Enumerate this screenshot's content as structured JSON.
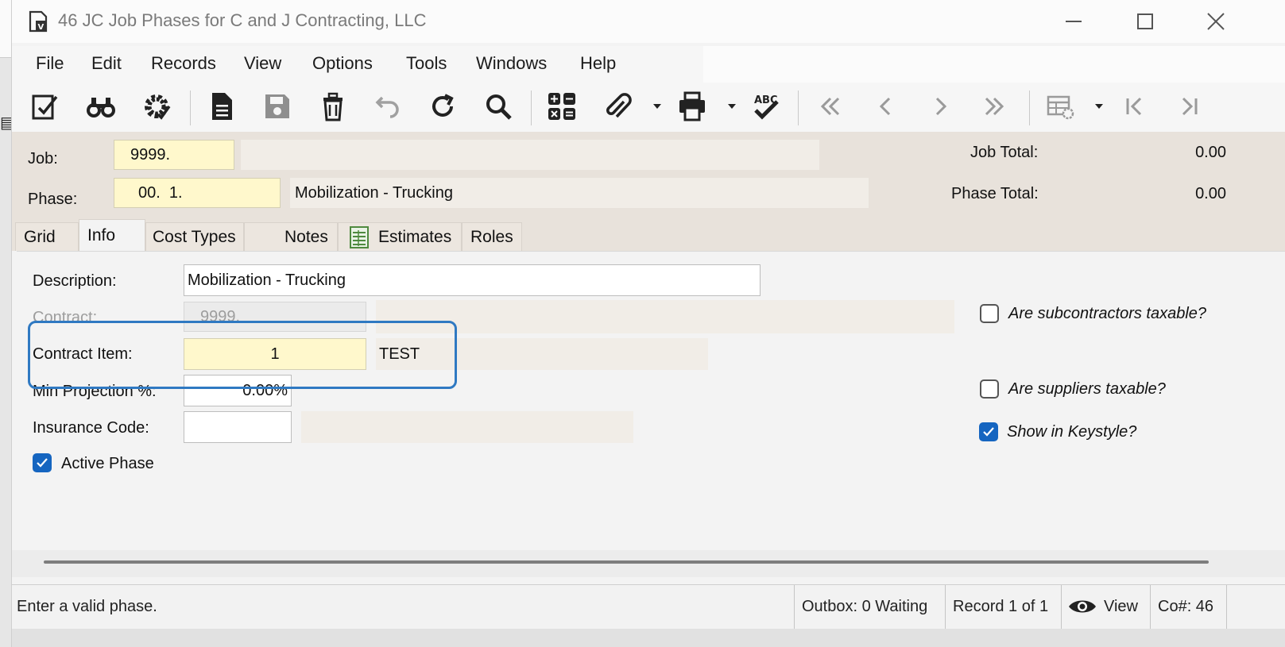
{
  "window": {
    "title": "46 JC Job Phases for C and J Contracting, LLC",
    "controls": [
      "minimize",
      "maximize",
      "close"
    ]
  },
  "menu": [
    "File",
    "Edit",
    "Records",
    "View",
    "Options",
    "Tools",
    "Windows",
    "Help"
  ],
  "toolbar": {
    "icons": [
      "validate-icon",
      "find-icon",
      "settings-icon",
      "new-record-icon",
      "save-icon",
      "delete-icon",
      "undo-icon",
      "refresh-icon",
      "search-icon",
      "calculator-icon",
      "attachment-icon",
      "print-icon",
      "spellcheck-icon",
      "first-record-icon",
      "previous-record-icon",
      "next-record-icon",
      "last-record-icon",
      "grid-settings-icon",
      "go-first-icon",
      "go-last-icon"
    ],
    "disabled": [
      "save-icon",
      "undo-icon",
      "first-record-icon",
      "previous-record-icon",
      "next-record-icon",
      "last-record-icon",
      "grid-settings-icon",
      "go-first-icon",
      "go-last-icon"
    ]
  },
  "header": {
    "job_label": "Job:",
    "job_value": "9999.",
    "job_desc": "",
    "phase_label": "Phase:",
    "phase_value": "00.  1.",
    "phase_desc": "Mobilization - Trucking",
    "job_total_label": "Job Total:",
    "job_total": "0.00",
    "phase_total_label": "Phase Total:",
    "phase_total": "0.00"
  },
  "tabs": [
    {
      "label": "Grid",
      "active": false
    },
    {
      "label": "Info",
      "active": true
    },
    {
      "label": "Cost Types",
      "active": false
    },
    {
      "label": "Notes",
      "active": false
    },
    {
      "label": "Estimates",
      "active": false
    },
    {
      "label": "Roles",
      "active": false
    }
  ],
  "info": {
    "description_label": "Description:",
    "description_value": "Mobilization - Trucking",
    "contract_label": "Contract:",
    "contract_value": "9999.",
    "contract_item_label": "Contract Item:",
    "contract_item_value": "1",
    "contract_item_desc": "TEST",
    "min_projection_label": "Min Projection %:",
    "min_projection_value": "0.00%",
    "insurance_code_label": "Insurance Code:",
    "insurance_code_value": "",
    "active_phase_label": "Active Phase",
    "active_phase_checked": true,
    "subcontractors_taxable_label": "Are subcontractors taxable?",
    "subcontractors_taxable_checked": false,
    "suppliers_taxable_label": "Are suppliers taxable?",
    "suppliers_taxable_checked": false,
    "show_in_keystyle_label": "Show in Keystyle?",
    "show_in_keystyle_checked": true
  },
  "status": {
    "message": "Enter a valid phase.",
    "outbox": "Outbox: 0 Waiting",
    "record": "Record 1 of 1",
    "view": "View",
    "company": "Co#: 46"
  },
  "colors": {
    "accent": "#1565c0",
    "highlight_border": "#2f79c2",
    "required_field": "#fff8cc",
    "header_bg": "#e8e2db"
  }
}
